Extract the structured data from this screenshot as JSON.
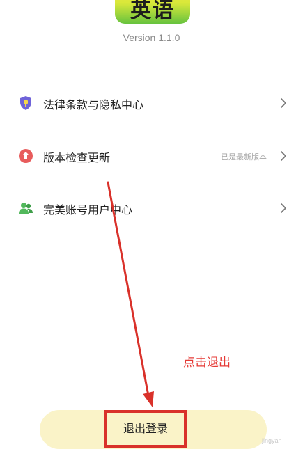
{
  "app": {
    "logo_text": "英语",
    "version": "Version 1.1.0"
  },
  "settings": {
    "items": [
      {
        "label": "法律条款与隐私中心",
        "value": "",
        "icon": "shield-icon",
        "icon_color": "#6f63d9"
      },
      {
        "label": "版本检查更新",
        "value": "已是最新版本",
        "icon": "upload-arrow-icon",
        "icon_color": "#e85c5c"
      },
      {
        "label": "完美账号用户中心",
        "value": "",
        "icon": "users-icon",
        "icon_color": "#52b85c"
      }
    ]
  },
  "annotation": {
    "text": "点击退出",
    "color": "#e53935"
  },
  "logout": {
    "label": "退出登录",
    "background": "#faf3c8",
    "highlight_color": "#d9312a"
  },
  "watermark": {
    "text": "jingyan"
  }
}
